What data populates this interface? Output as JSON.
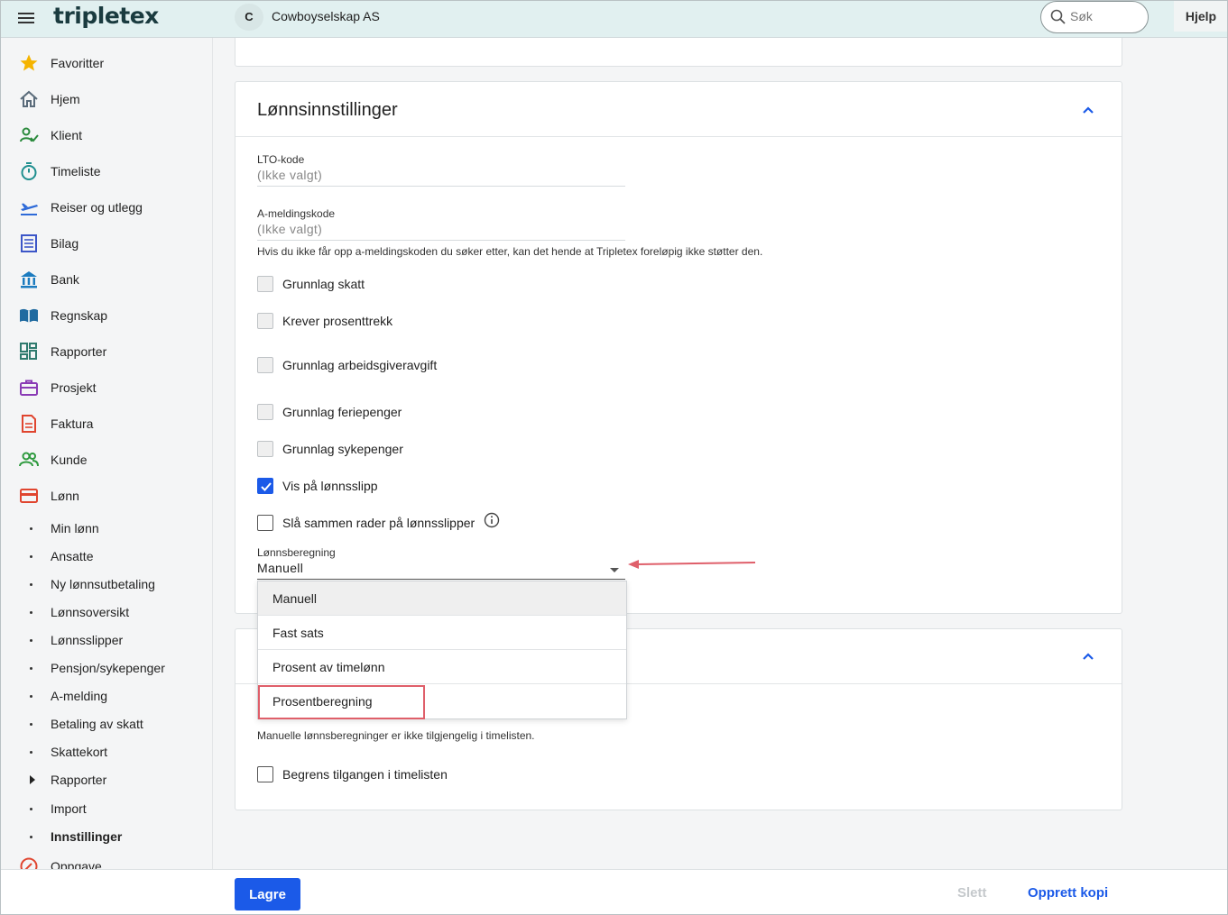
{
  "header": {
    "logo": "tripletex",
    "company_initial": "C",
    "company_name": "Cowboyselskap AS",
    "search_placeholder": "Søk",
    "help_label": "Hjelp"
  },
  "sidebar": {
    "items": [
      {
        "label": "Favoritter",
        "icon": "star-icon",
        "color": "#f5b400"
      },
      {
        "label": "Hjem",
        "icon": "home-icon",
        "color": "#5a6b7a"
      },
      {
        "label": "Klient",
        "icon": "client-icon",
        "color": "#2a8a3c"
      },
      {
        "label": "Timeliste",
        "icon": "stopwatch-icon",
        "color": "#1f8f8f"
      },
      {
        "label": "Reiser og utlegg",
        "icon": "plane-icon",
        "color": "#2d6ad8"
      },
      {
        "label": "Bilag",
        "icon": "receipt-icon",
        "color": "#3c56c8"
      },
      {
        "label": "Bank",
        "icon": "bank-icon",
        "color": "#1b7bbf"
      },
      {
        "label": "Regnskap",
        "icon": "book-icon",
        "color": "#1f6aa0"
      },
      {
        "label": "Rapporter",
        "icon": "dashboard-icon",
        "color": "#2f7a6e"
      },
      {
        "label": "Prosjekt",
        "icon": "briefcase-icon",
        "color": "#8a3bb5"
      },
      {
        "label": "Faktura",
        "icon": "invoice-icon",
        "color": "#e0452f"
      },
      {
        "label": "Kunde",
        "icon": "customers-icon",
        "color": "#2e9a3e"
      },
      {
        "label": "Lønn",
        "icon": "wallet-icon",
        "color": "#e0452f"
      }
    ],
    "sub_items": [
      {
        "label": "Min lønn"
      },
      {
        "label": "Ansatte"
      },
      {
        "label": "Ny lønnsutbetaling"
      },
      {
        "label": "Lønnsoversikt"
      },
      {
        "label": "Lønnsslipper"
      },
      {
        "label": "Pensjon/sykepenger"
      },
      {
        "label": "A-melding"
      },
      {
        "label": "Betaling av skatt"
      },
      {
        "label": "Skattekort"
      },
      {
        "label": "Rapporter"
      },
      {
        "label": "Import"
      },
      {
        "label": "Innstillinger"
      }
    ],
    "last_item": {
      "label": "Oppgave",
      "icon": "task-icon",
      "color": "#e0452f"
    }
  },
  "lonn_card": {
    "title": "Lønnsinnstillinger",
    "lto_label": "LTO-kode",
    "lto_value": "(Ikke valgt)",
    "amelding_label": "A-meldingskode",
    "amelding_value": "(Ikke valgt)",
    "amelding_hint": "Hvis du ikke får opp a-meldingskoden du søker etter, kan det hende at Tripletex foreløpig ikke støtter den.",
    "checkboxes": [
      {
        "label": "Grunnlag skatt",
        "checked": false
      },
      {
        "label": "Krever prosenttrekk",
        "checked": false
      },
      {
        "label": "Grunnlag arbeidsgiveravgift",
        "checked": false
      },
      {
        "label": "Grunnlag feriepenger",
        "checked": false
      },
      {
        "label": "Grunnlag sykepenger",
        "checked": false
      },
      {
        "label": "Vis på lønnsslipp",
        "checked": true
      },
      {
        "label": "Slå sammen rader på lønnsslipper",
        "checked": false
      }
    ],
    "lonnsberegning_label": "Lønnsberegning",
    "lonnsberegning_value": "Manuell"
  },
  "dropdown": {
    "options": [
      "Manuell",
      "Fast sats",
      "Prosent av timelønn",
      "Prosentberegning"
    ],
    "selected": "Manuell"
  },
  "bottom_card": {
    "hint": "Manuelle lønnsberegninger er ikke tilgjengelig i timelisten.",
    "checkbox_label": "Begrens tilgangen i timelisten"
  },
  "footer": {
    "save_label": "Lagre",
    "delete_label": "Slett",
    "copy_label": "Opprett kopi"
  },
  "colors": {
    "accent": "#1b5ae8",
    "header_bg": "#e1f0f0",
    "highlight": "#df5f6a"
  }
}
